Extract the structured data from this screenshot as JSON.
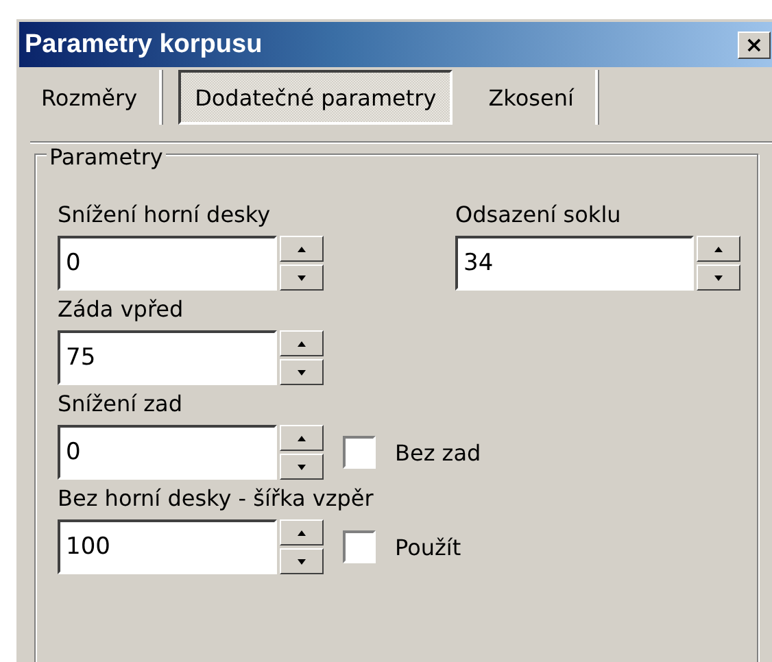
{
  "window": {
    "title": "Parametry korpusu",
    "close": "×"
  },
  "tabs": [
    {
      "label": "Rozměry",
      "selected": false
    },
    {
      "label": "Dodatečné parametry",
      "selected": true
    },
    {
      "label": "Zkosení",
      "selected": false
    }
  ],
  "group": {
    "title": "Parametry",
    "rows": [
      {
        "fields": [
          {
            "label": "Snížení horní desky",
            "value": "0"
          },
          {
            "label": "Odsazení soklu",
            "value": "34"
          }
        ]
      },
      {
        "fields": [
          {
            "label": "Záda vpřed",
            "value": "75"
          }
        ]
      },
      {
        "fields": [
          {
            "label": "Snížení zad",
            "value": "0",
            "checkbox": {
              "label": "Bez zad",
              "checked": false
            }
          }
        ]
      },
      {
        "fields": [
          {
            "label": "Bez horní desky - šířka vzpěr",
            "value": "100",
            "checkbox": {
              "label": "Použít",
              "checked": false
            }
          }
        ]
      }
    ]
  }
}
